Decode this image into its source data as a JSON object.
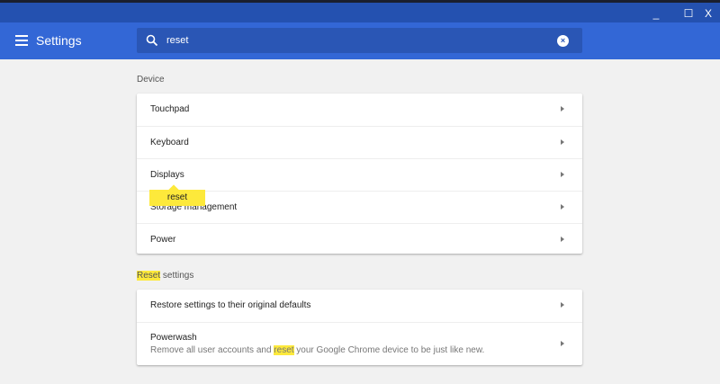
{
  "window": {
    "minimize": "_",
    "maximize": "☐",
    "close": "X"
  },
  "header": {
    "title": "Settings",
    "search_value": "reset",
    "clear_icon": "×"
  },
  "sections": [
    {
      "title": "Device",
      "items": [
        {
          "label": "Touchpad"
        },
        {
          "label": "Keyboard"
        },
        {
          "label": "Displays"
        },
        {
          "label": "Storage management"
        },
        {
          "label": "Power"
        }
      ]
    },
    {
      "title_highlight": "Reset",
      "title_rest": " settings",
      "items": [
        {
          "label": "Restore settings to their original defaults"
        },
        {
          "label": "Powerwash",
          "sub_pre": "Remove all user accounts and ",
          "sub_highlight": "reset",
          "sub_post": " your Google Chrome device to be just like new."
        }
      ]
    }
  ],
  "tooltip": "reset",
  "colors": {
    "header": "#3367d6",
    "titlebar": "#2451b0",
    "highlight": "#fde93b"
  }
}
